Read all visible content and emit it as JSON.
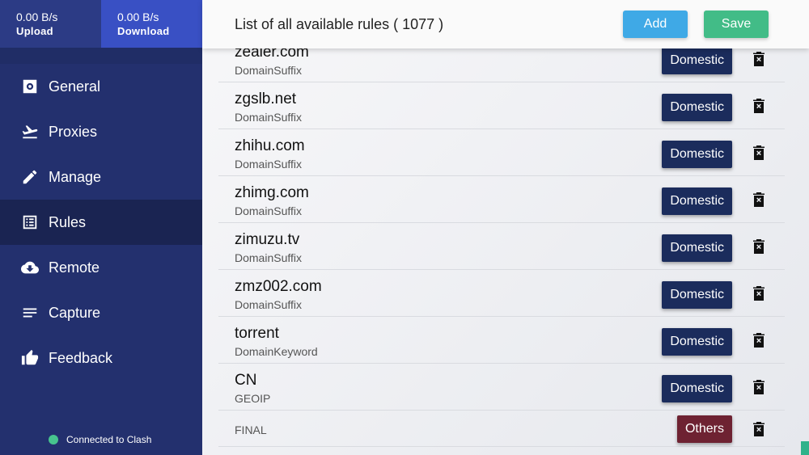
{
  "traffic": {
    "upload_value": "0.00 B/s",
    "upload_label": "Upload",
    "download_value": "0.00 B/s",
    "download_label": "Download"
  },
  "nav": [
    {
      "label": "General",
      "icon": "gear-icon"
    },
    {
      "label": "Proxies",
      "icon": "plane-departure-icon"
    },
    {
      "label": "Manage",
      "icon": "pencil-icon"
    },
    {
      "label": "Rules",
      "icon": "list-icon"
    },
    {
      "label": "Remote",
      "icon": "cloud-download-icon"
    },
    {
      "label": "Capture",
      "icon": "lines-icon"
    },
    {
      "label": "Feedback",
      "icon": "thumbs-up-icon"
    }
  ],
  "status": {
    "text": "Connected to Clash",
    "color": "#47c48e"
  },
  "header": {
    "title": "List of all available rules ( 1077 )",
    "add_label": "Add",
    "save_label": "Save"
  },
  "rules": [
    {
      "name": "zealer.com",
      "type": "DomainSuffix",
      "policy": "Domestic"
    },
    {
      "name": "zgslb.net",
      "type": "DomainSuffix",
      "policy": "Domestic"
    },
    {
      "name": "zhihu.com",
      "type": "DomainSuffix",
      "policy": "Domestic"
    },
    {
      "name": "zhimg.com",
      "type": "DomainSuffix",
      "policy": "Domestic"
    },
    {
      "name": "zimuzu.tv",
      "type": "DomainSuffix",
      "policy": "Domestic"
    },
    {
      "name": "zmz002.com",
      "type": "DomainSuffix",
      "policy": "Domestic"
    },
    {
      "name": "torrent",
      "type": "DomainKeyword",
      "policy": "Domestic"
    },
    {
      "name": "CN",
      "type": "GEOIP",
      "policy": "Domestic"
    }
  ],
  "final_rule": {
    "type": "FINAL",
    "policy": "Others"
  },
  "colors": {
    "sidebar": "#23306e",
    "active_nav": "#1a2452",
    "download_bg": "#3950c4",
    "add_button": "#3fa9e6",
    "save_button": "#42bc87",
    "domestic_tag": "#1b2c5c",
    "others_tag": "#6e2232"
  }
}
